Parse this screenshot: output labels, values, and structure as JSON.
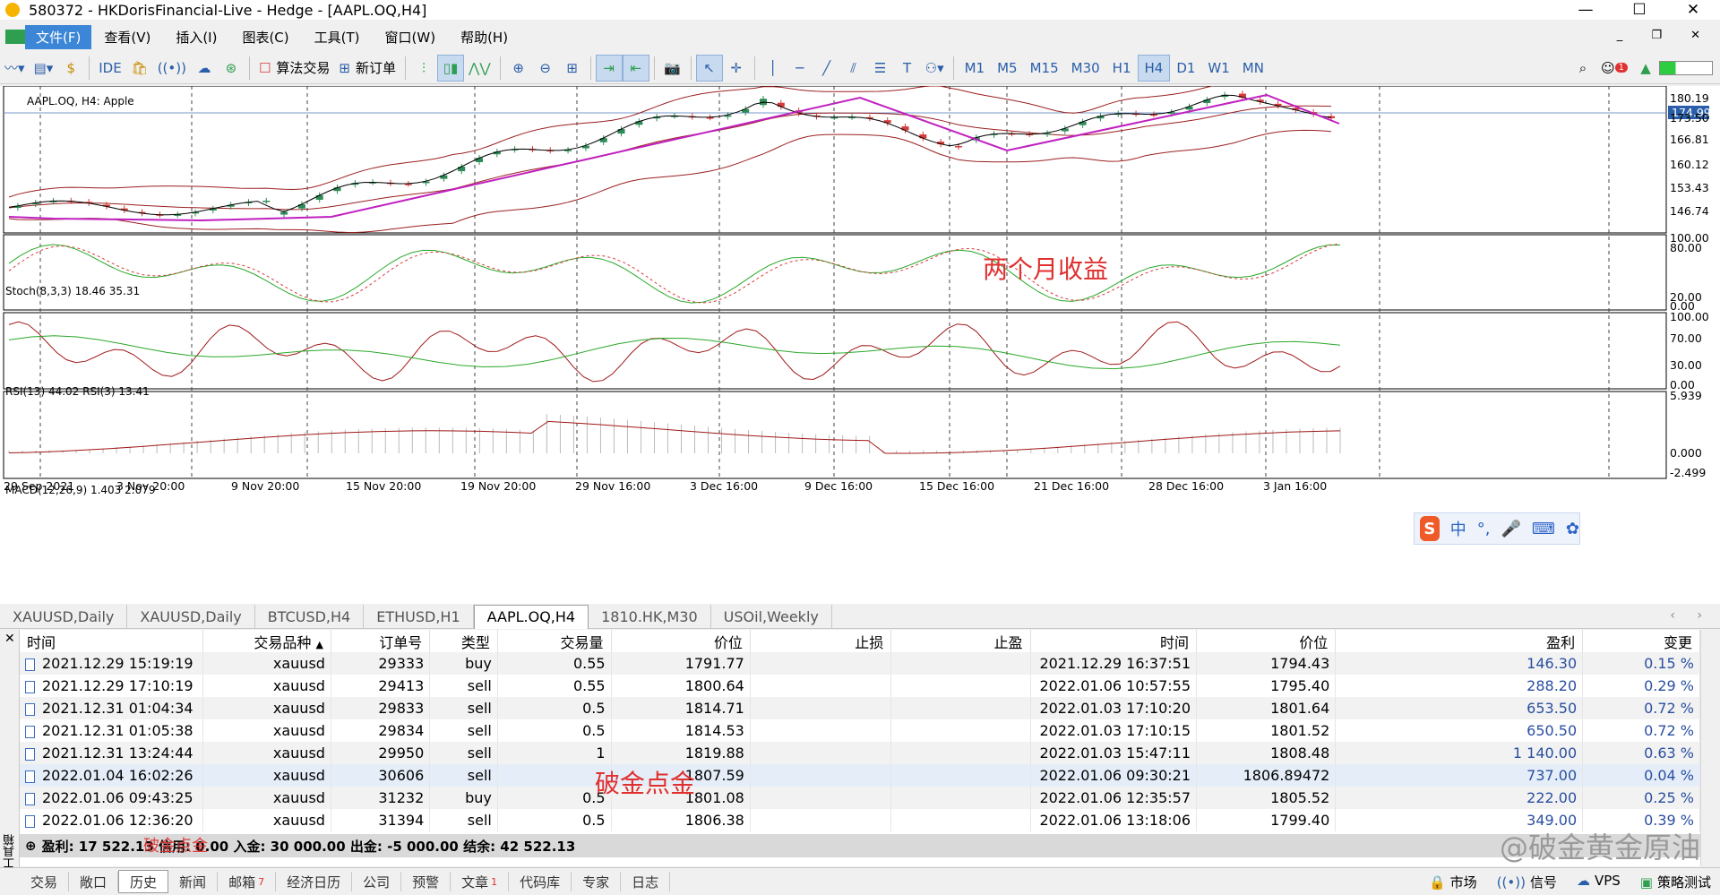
{
  "window": {
    "title": "580372 - HKDorisFinancial-Live - Hedge - [AAPL.OQ,H4]",
    "controls": [
      "—",
      "☐",
      "✕"
    ]
  },
  "menu": [
    "文件(F)",
    "查看(V)",
    "插入(I)",
    "图表(C)",
    "工具(T)",
    "窗口(W)",
    "帮助(H)"
  ],
  "toolbar": {
    "ide_label": "IDE",
    "algo_trading_label": "算法交易",
    "new_order_label": "新订单",
    "timeframes": [
      "M1",
      "M5",
      "M15",
      "M30",
      "H1",
      "H4",
      "D1",
      "W1",
      "MN"
    ],
    "active_timeframe": "H4",
    "notification_count": "1"
  },
  "chart": {
    "header": "AAPL.OQ, H4:  Apple",
    "price_labels": [
      "180.19",
      "174.99",
      "173.50",
      "166.81",
      "160.12",
      "153.43",
      "146.74"
    ],
    "current_price": "174.99",
    "annotation": "两个月收益",
    "x_labels": [
      "29 Sep 2021",
      "3 Nov 20:00",
      "9 Nov 20:00",
      "15 Nov 20:00",
      "19 Nov 20:00",
      "29 Nov 16:00",
      "3 Dec 16:00",
      "9 Dec 16:00",
      "15 Dec 16:00",
      "21 Dec 16:00",
      "28 Dec 16:00",
      "3 Jan 16:00"
    ],
    "stoch": {
      "label": "Stoch(8,3,3) 18.46 35.31",
      "levels": [
        "100.00",
        "80.00",
        "20.00",
        "0.00"
      ]
    },
    "rsi": {
      "label": "RSI(13) 44.02 RSI(3) 13.41",
      "levels": [
        "100.00",
        "70.00",
        "30.00",
        "0.00"
      ]
    },
    "macd": {
      "label": "MACD(12,26,9) 1.403 2.079",
      "levels": [
        "5.939",
        "0.000",
        "-2.499"
      ]
    },
    "colors": {
      "bull": "#2e8b57",
      "bear": "#d83a3a",
      "zigzag": "#c020c0",
      "band": "#9b2020"
    }
  },
  "ime": {
    "logo": "S",
    "mode": "中",
    "punct": "°,",
    "mic": "🎤",
    "keyboard": "⌨",
    "more": "✿"
  },
  "symbol_tabs": [
    "XAUUSD,Daily",
    "XAUUSD,Daily",
    "BTCUSD,H4",
    "ETHUSD,H1",
    "AAPL.OQ,H4",
    "1810.HK,M30",
    "USOil,Weekly"
  ],
  "active_symbol_tab": "AAPL.OQ,H4",
  "history": {
    "columns": [
      "时间",
      "交易品种",
      "订单号",
      "类型",
      "交易量",
      "价位",
      "止损",
      "止盈",
      "时间",
      "价位",
      "盈利",
      "变更"
    ],
    "sort_marker": "▲",
    "rows": [
      [
        "2021.12.29 15:19:19",
        "xauusd",
        "29333",
        "buy",
        "0.55",
        "1791.77",
        "",
        "",
        "2021.12.29 16:37:51",
        "1794.43",
        "146.30",
        "0.15 %"
      ],
      [
        "2021.12.29 17:10:19",
        "xauusd",
        "29413",
        "sell",
        "0.55",
        "1800.64",
        "",
        "",
        "2022.01.06 10:57:55",
        "1795.40",
        "288.20",
        "0.29 %"
      ],
      [
        "2021.12.31 01:04:34",
        "xauusd",
        "29833",
        "sell",
        "0.5",
        "1814.71",
        "",
        "",
        "2022.01.03 17:10:20",
        "1801.64",
        "653.50",
        "0.72 %"
      ],
      [
        "2021.12.31 01:05:38",
        "xauusd",
        "29834",
        "sell",
        "0.5",
        "1814.53",
        "",
        "",
        "2022.01.03 17:10:15",
        "1801.52",
        "650.50",
        "0.72 %"
      ],
      [
        "2021.12.31 13:24:44",
        "xauusd",
        "29950",
        "sell",
        "1",
        "1819.88",
        "",
        "",
        "2022.01.03 15:47:11",
        "1808.48",
        "1 140.00",
        "0.63 %"
      ],
      [
        "2022.01.04 16:02:26",
        "xauusd",
        "30606",
        "sell",
        "",
        "1807.59",
        "",
        "",
        "2022.01.06 09:30:21",
        "1806.89472",
        "737.00",
        "0.04 %"
      ],
      [
        "2022.01.06 09:43:25",
        "xauusd",
        "31232",
        "buy",
        "0.5",
        "1801.08",
        "",
        "",
        "2022.01.06 12:35:57",
        "1805.52",
        "222.00",
        "0.25 %"
      ],
      [
        "2022.01.06 12:36:20",
        "xauusd",
        "31394",
        "sell",
        "0.5",
        "1806.38",
        "",
        "",
        "2022.01.06 13:18:06",
        "1799.40",
        "349.00",
        "0.39 %"
      ]
    ],
    "summary": "盈利: 17 522.13  信用: 0.00  入金: 30 000.00  出金: -5 000.00  结余: 42 522.13",
    "summary_right": "17 5__.__",
    "annotation": "破金点金",
    "annotation_small": "破金点金",
    "watermark": "@破金黄金原油"
  },
  "side_label": "工具箱",
  "bottom_tabs": [
    {
      "label": "交易",
      "badge": ""
    },
    {
      "label": "敞口",
      "badge": ""
    },
    {
      "label": "历史",
      "badge": ""
    },
    {
      "label": "新闻",
      "badge": ""
    },
    {
      "label": "邮箱",
      "badge": "7"
    },
    {
      "label": "经济日历",
      "badge": ""
    },
    {
      "label": "公司",
      "badge": ""
    },
    {
      "label": "预警",
      "badge": ""
    },
    {
      "label": "文章",
      "badge": "1"
    },
    {
      "label": "代码库",
      "badge": ""
    },
    {
      "label": "专家",
      "badge": ""
    },
    {
      "label": "日志",
      "badge": ""
    }
  ],
  "active_bottom_tab": "历史",
  "status": {
    "market": "市场",
    "signals": "信号",
    "vps": "VPS",
    "tester": "策略测试"
  }
}
